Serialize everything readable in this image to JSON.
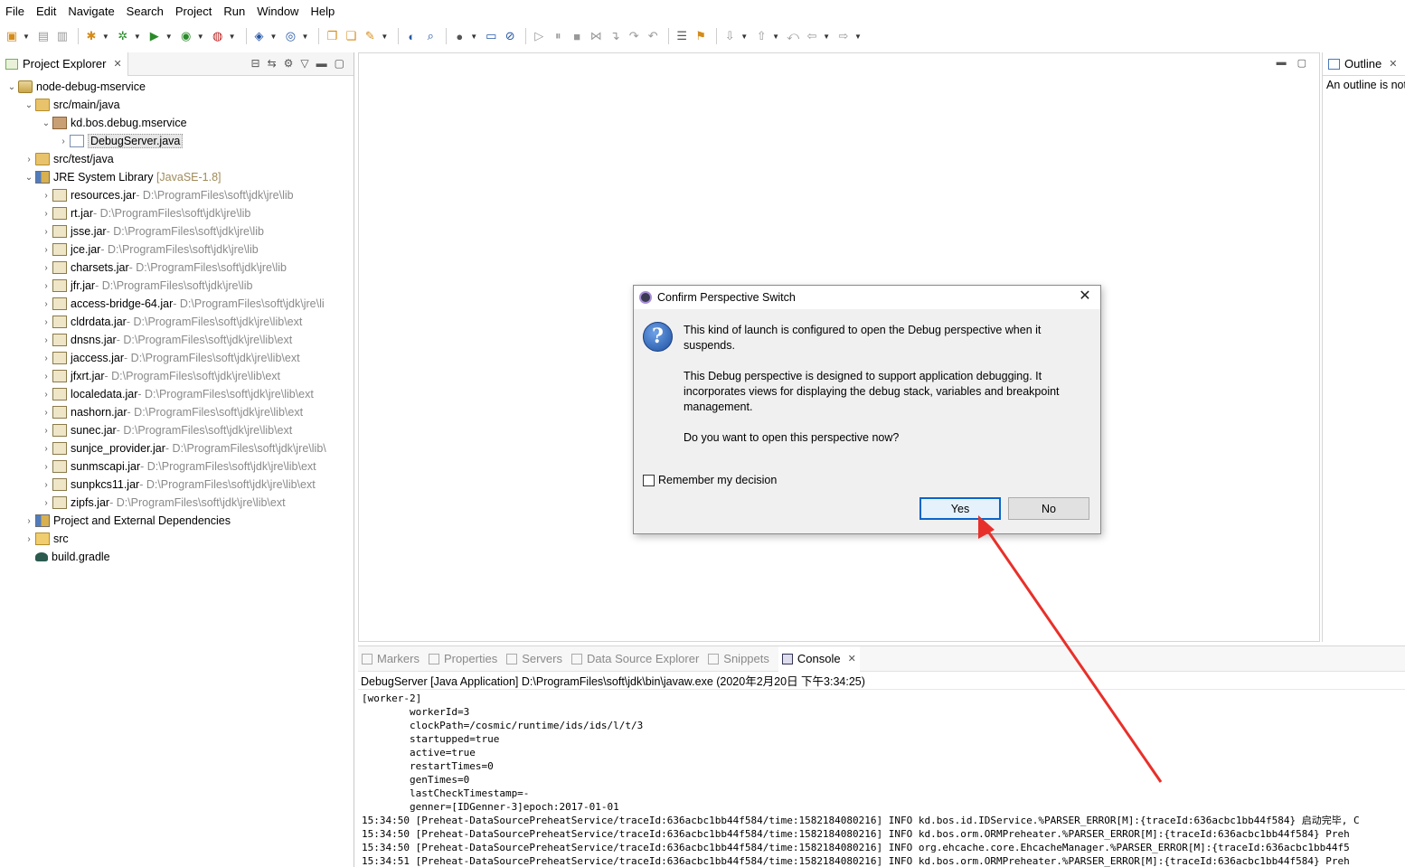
{
  "menu": [
    "File",
    "Edit",
    "Navigate",
    "Search",
    "Project",
    "Run",
    "Window",
    "Help"
  ],
  "explorer": {
    "tab_label": "Project Explorer",
    "project": "node-debug-mservice",
    "src_main": "src/main/java",
    "package": "kd.bos.debug.mservice",
    "java_file": "DebugServer.java",
    "src_test": "src/test/java",
    "jre_label": "JRE System Library",
    "jre_version": "[JavaSE-1.8]",
    "jars": [
      {
        "name": "resources.jar",
        "path": " - D:\\ProgramFiles\\soft\\jdk\\jre\\lib"
      },
      {
        "name": "rt.jar",
        "path": " - D:\\ProgramFiles\\soft\\jdk\\jre\\lib"
      },
      {
        "name": "jsse.jar",
        "path": " - D:\\ProgramFiles\\soft\\jdk\\jre\\lib"
      },
      {
        "name": "jce.jar",
        "path": " - D:\\ProgramFiles\\soft\\jdk\\jre\\lib"
      },
      {
        "name": "charsets.jar",
        "path": " - D:\\ProgramFiles\\soft\\jdk\\jre\\lib"
      },
      {
        "name": "jfr.jar",
        "path": " - D:\\ProgramFiles\\soft\\jdk\\jre\\lib"
      },
      {
        "name": "access-bridge-64.jar",
        "path": " - D:\\ProgramFiles\\soft\\jdk\\jre\\li"
      },
      {
        "name": "cldrdata.jar",
        "path": " - D:\\ProgramFiles\\soft\\jdk\\jre\\lib\\ext"
      },
      {
        "name": "dnsns.jar",
        "path": " - D:\\ProgramFiles\\soft\\jdk\\jre\\lib\\ext"
      },
      {
        "name": "jaccess.jar",
        "path": " - D:\\ProgramFiles\\soft\\jdk\\jre\\lib\\ext"
      },
      {
        "name": "jfxrt.jar",
        "path": " - D:\\ProgramFiles\\soft\\jdk\\jre\\lib\\ext"
      },
      {
        "name": "localedata.jar",
        "path": " - D:\\ProgramFiles\\soft\\jdk\\jre\\lib\\ext"
      },
      {
        "name": "nashorn.jar",
        "path": " - D:\\ProgramFiles\\soft\\jdk\\jre\\lib\\ext"
      },
      {
        "name": "sunec.jar",
        "path": " - D:\\ProgramFiles\\soft\\jdk\\jre\\lib\\ext"
      },
      {
        "name": "sunjce_provider.jar",
        "path": " - D:\\ProgramFiles\\soft\\jdk\\jre\\lib\\"
      },
      {
        "name": "sunmscapi.jar",
        "path": " - D:\\ProgramFiles\\soft\\jdk\\jre\\lib\\ext"
      },
      {
        "name": "sunpkcs11.jar",
        "path": " - D:\\ProgramFiles\\soft\\jdk\\jre\\lib\\ext"
      },
      {
        "name": "zipfs.jar",
        "path": " - D:\\ProgramFiles\\soft\\jdk\\jre\\lib\\ext"
      }
    ],
    "deps": "Project and External Dependencies",
    "src": "src",
    "build": "build.gradle"
  },
  "outline": {
    "tab_label": "Outline",
    "message": "An outline is not available."
  },
  "console": {
    "tabs": [
      "Markers",
      "Properties",
      "Servers",
      "Data Source Explorer",
      "Snippets",
      "Console"
    ],
    "title": "DebugServer [Java Application] D:\\ProgramFiles\\soft\\jdk\\bin\\javaw.exe (2020年2月20日 下午3:34:25)",
    "lines": [
      "[worker-2]",
      "        workerId=3",
      "        clockPath=/cosmic/runtime/ids/ids/l/t/3",
      "        startupped=true",
      "        active=true",
      "        restartTimes=0",
      "        genTimes=0",
      "        lastCheckTimestamp=-",
      "        genner=[IDGenner-3]epoch:2017-01-01",
      "15:34:50 [Preheat-DataSourcePreheatService/traceId:636acbc1bb44f584/time:1582184080216] INFO kd.bos.id.IDService.%PARSER_ERROR[M]:{traceId:636acbc1bb44f584} 启动完毕, C",
      "15:34:50 [Preheat-DataSourcePreheatService/traceId:636acbc1bb44f584/time:1582184080216] INFO kd.bos.orm.ORMPreheater.%PARSER_ERROR[M]:{traceId:636acbc1bb44f584} Preh",
      "15:34:50 [Preheat-DataSourcePreheatService/traceId:636acbc1bb44f584/time:1582184080216] INFO org.ehcache.core.EhcacheManager.%PARSER_ERROR[M]:{traceId:636acbc1bb44f5",
      "15:34:51 [Preheat-DataSourcePreheatService/traceId:636acbc1bb44f584/time:1582184080216] INFO kd.bos.orm.ORMPreheater.%PARSER_ERROR[M]:{traceId:636acbc1bb44f584} Preh"
    ]
  },
  "dialog": {
    "title": "Confirm Perspective Switch",
    "msg1": "This kind of launch is configured to open the Debug perspective when it suspends.",
    "msg2": "This Debug perspective is designed to support application debugging.  It incorporates views for displaying the debug stack, variables and breakpoint management.",
    "msg3": "Do you want to open this perspective now?",
    "remember": "Remember my decision",
    "yes": "Yes",
    "no": "No"
  },
  "colors": {
    "arrow": "#e8302a",
    "focus": "#0a64c8"
  }
}
